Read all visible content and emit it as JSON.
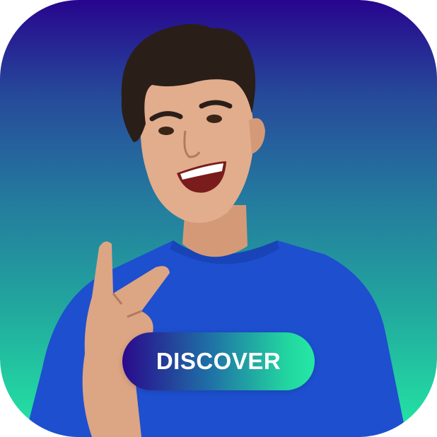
{
  "cta": {
    "label": "DISCOVER"
  },
  "colors": {
    "gradient_top": "#27058e",
    "gradient_bottom": "#23e8a3",
    "shirt": "#1e4fcf",
    "button_start": "#2a0a8c",
    "button_end": "#25e8a4"
  },
  "image": {
    "subject": "smiling-man-peace-sign"
  }
}
